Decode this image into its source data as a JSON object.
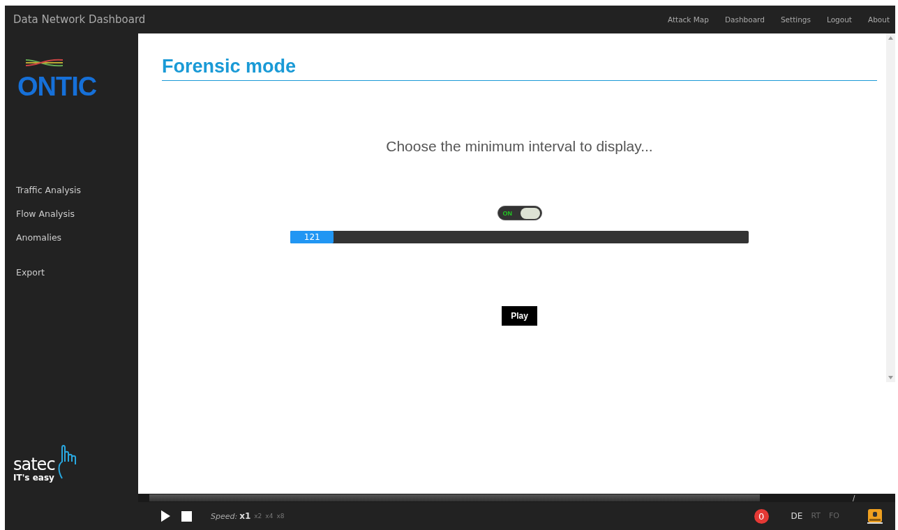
{
  "header": {
    "title": "Data Network Dashboard",
    "nav": [
      {
        "label": "Attack Map"
      },
      {
        "label": "Dashboard"
      },
      {
        "label": "Settings"
      },
      {
        "label": "Logout"
      },
      {
        "label": "About"
      }
    ]
  },
  "sidebar": {
    "logo": "ONTIC",
    "items": [
      {
        "label": "Traffic Analysis"
      },
      {
        "label": "Flow Analysis"
      },
      {
        "label": "Anomalies"
      },
      {
        "label": "Export"
      }
    ],
    "footer_logo": {
      "name": "satec",
      "tagline": "IT's easy"
    }
  },
  "page": {
    "title": "Forensic mode",
    "prompt": "Choose the minimum interval to display...",
    "toggle": {
      "label": "ON",
      "on": true
    },
    "slider": {
      "reading": "121",
      "level": 0.095
    },
    "play_button": "Play"
  },
  "player": {
    "timeline": {
      "level": 0.875,
      "marker": "/"
    },
    "speed_label": "Speed:",
    "speeds": [
      {
        "label": "x1",
        "selected": true
      },
      {
        "label": "x2",
        "selected": false
      },
      {
        "label": "x4",
        "selected": false
      },
      {
        "label": "x8",
        "selected": false
      }
    ],
    "alerts": "0",
    "modes": [
      {
        "label": "DE",
        "selected": true
      },
      {
        "label": "RT",
        "selected": false
      },
      {
        "label": "FO",
        "selected": false
      }
    ]
  }
}
